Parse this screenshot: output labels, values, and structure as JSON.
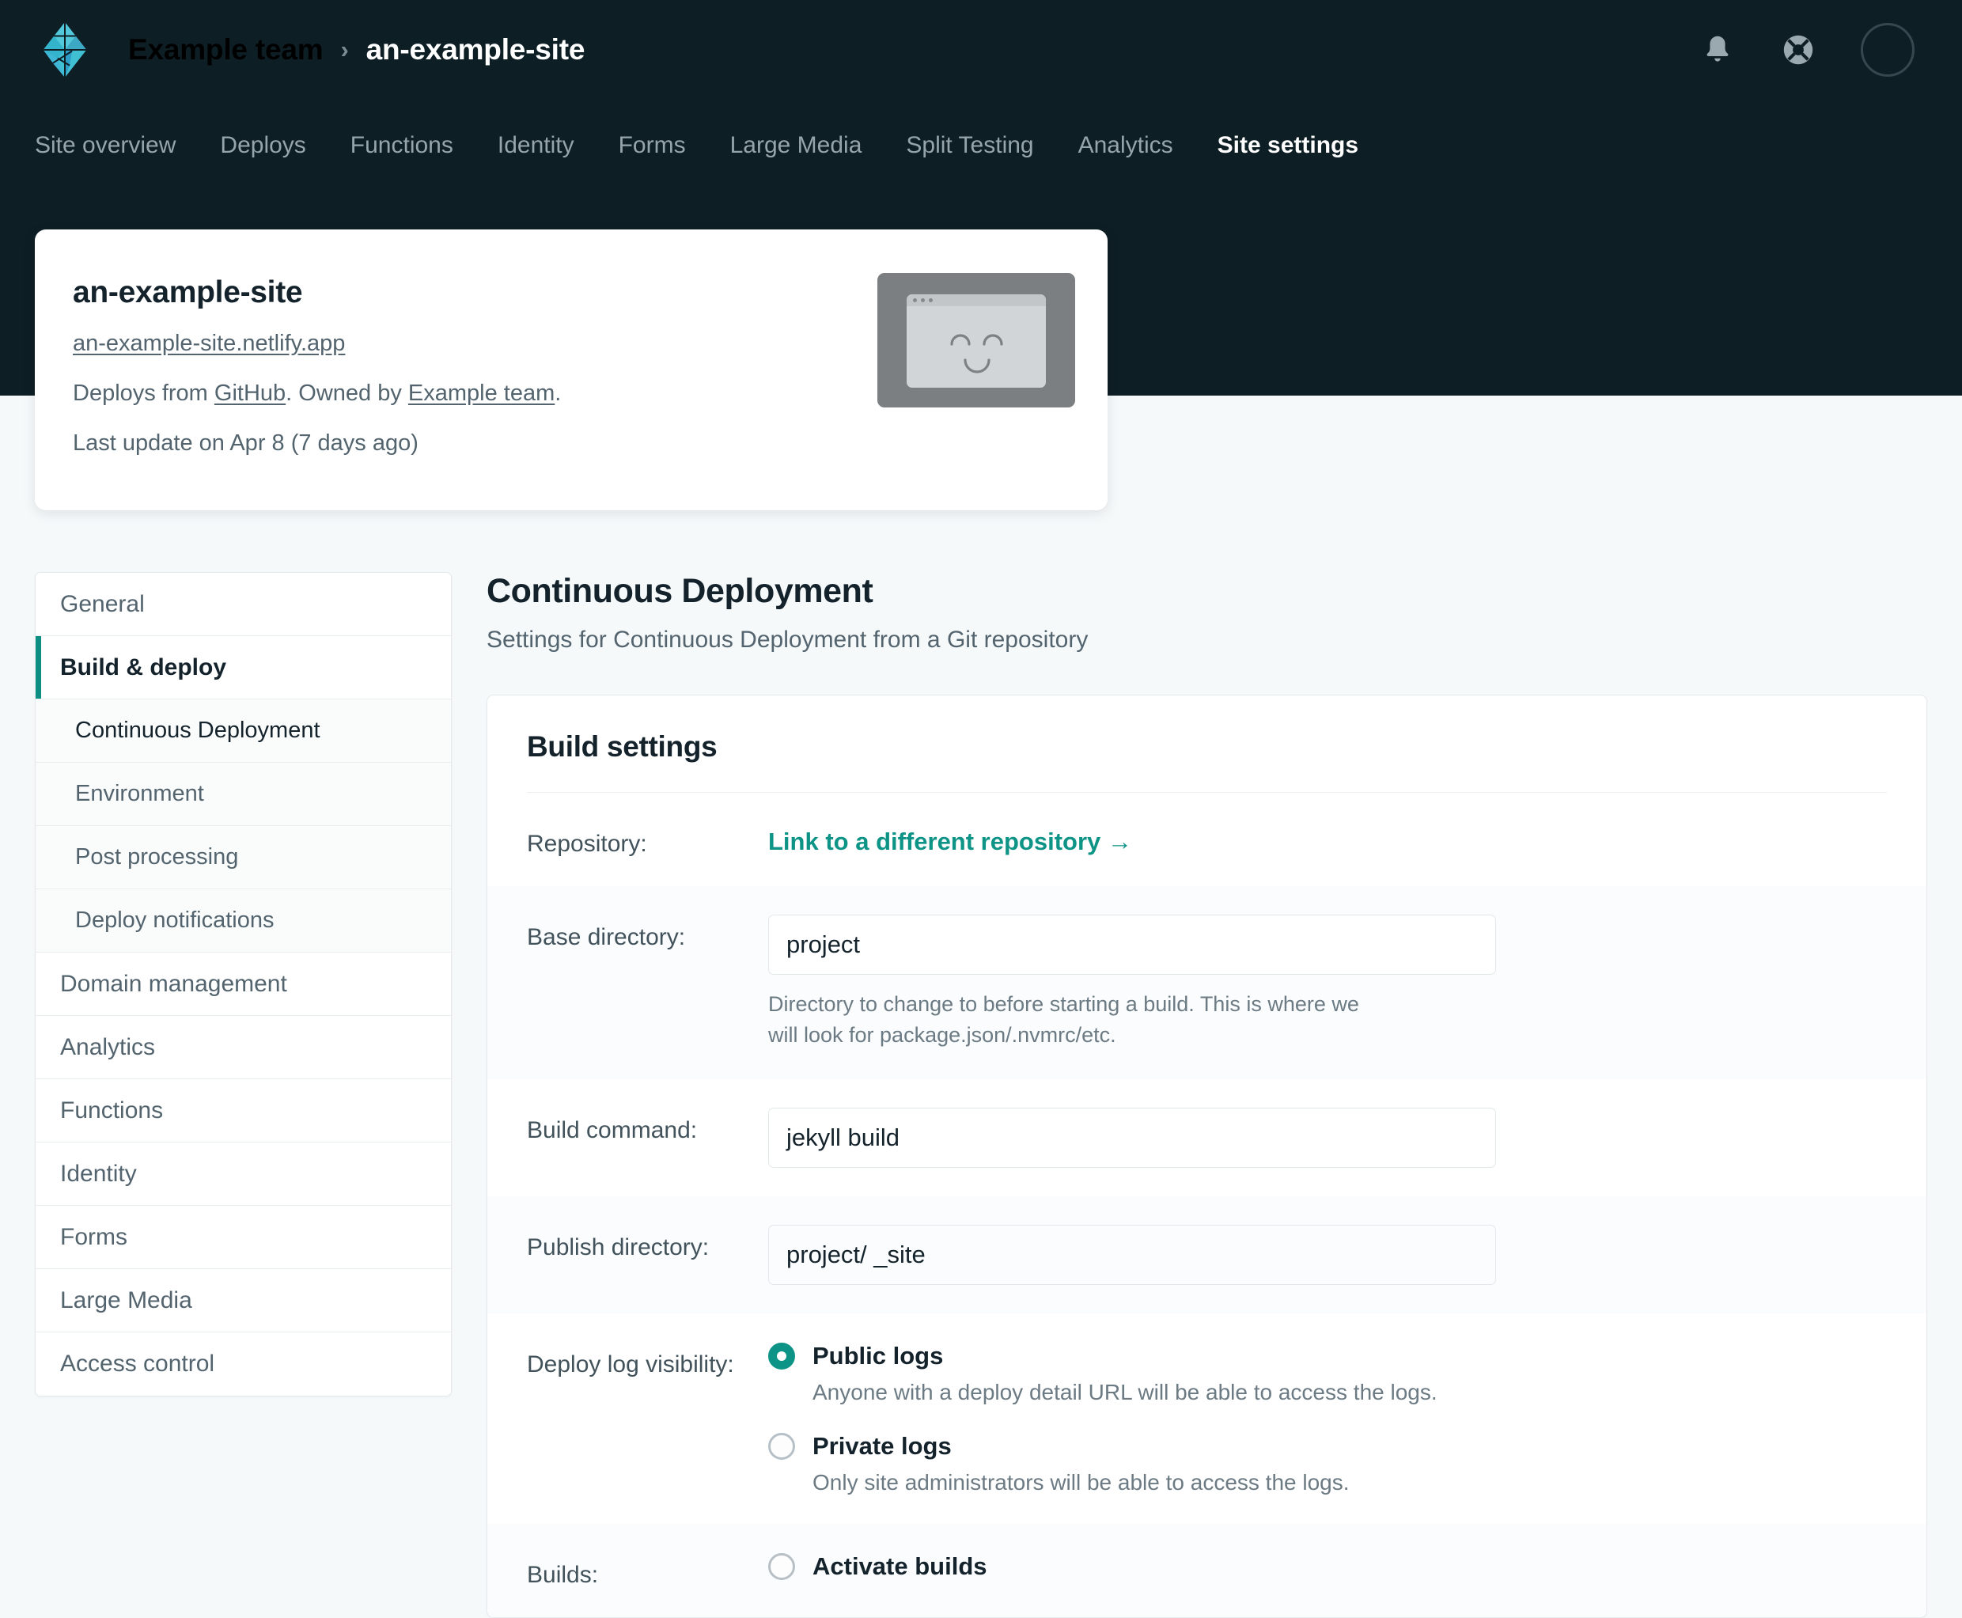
{
  "header": {
    "logo_icon": "netlify-diamond-logo",
    "breadcrumb": {
      "team": "Example team",
      "separator": "›",
      "site": "an-example-site"
    },
    "actions": [
      {
        "icon": "bell-icon",
        "name": "notifications"
      },
      {
        "icon": "life-ring-icon",
        "name": "help"
      },
      {
        "icon": "avatar-icon",
        "name": "user-avatar"
      }
    ],
    "nav": [
      {
        "label": "Site overview",
        "active": false
      },
      {
        "label": "Deploys",
        "active": false
      },
      {
        "label": "Functions",
        "active": false
      },
      {
        "label": "Identity",
        "active": false
      },
      {
        "label": "Forms",
        "active": false
      },
      {
        "label": "Large Media",
        "active": false
      },
      {
        "label": "Split Testing",
        "active": false
      },
      {
        "label": "Analytics",
        "active": false
      },
      {
        "label": "Site settings",
        "active": true
      }
    ]
  },
  "site_card": {
    "title": "an-example-site",
    "url": "an-example-site.netlify.app",
    "deploys_prefix": "Deploys from ",
    "deploys_source": "GitHub",
    "owned_mid": ". Owned by ",
    "owner": "Example team",
    "owned_suffix": ".",
    "last_update": "Last update on Apr 8 (7 days ago)",
    "thumbnail_icon": "smiley-browser-placeholder"
  },
  "settings_nav": [
    {
      "label": "General",
      "level": "top",
      "active": false
    },
    {
      "label": "Build & deploy",
      "level": "top",
      "active": true
    },
    {
      "label": "Continuous Deployment",
      "level": "sub",
      "current": true
    },
    {
      "label": "Environment",
      "level": "sub",
      "current": false
    },
    {
      "label": "Post processing",
      "level": "sub",
      "current": false
    },
    {
      "label": "Deploy notifications",
      "level": "sub",
      "current": false
    },
    {
      "label": "Domain management",
      "level": "top",
      "active": false
    },
    {
      "label": "Analytics",
      "level": "top",
      "active": false
    },
    {
      "label": "Functions",
      "level": "top",
      "active": false
    },
    {
      "label": "Identity",
      "level": "top",
      "active": false
    },
    {
      "label": "Forms",
      "level": "top",
      "active": false
    },
    {
      "label": "Large Media",
      "level": "top",
      "active": false
    },
    {
      "label": "Access control",
      "level": "top",
      "active": false
    }
  ],
  "main": {
    "title": "Continuous Deployment",
    "subtitle": "Settings for Continuous Deployment from a Git repository",
    "panel_title": "Build settings",
    "rows": {
      "repository": {
        "label": "Repository:",
        "link_label": "Link to a different repository →"
      },
      "base_directory": {
        "label": "Base directory:",
        "value": "project",
        "help": "Directory to change to before starting a build. This is where we will look for package.json/.nvmrc/etc."
      },
      "build_command": {
        "label": "Build command:",
        "value": "jekyll build"
      },
      "publish_directory": {
        "label": "Publish directory:",
        "value": "project/  _site"
      },
      "deploy_log_visibility": {
        "label": "Deploy log visibility:",
        "options": [
          {
            "label": "Public logs",
            "help": "Anyone with a deploy detail URL will be able to access the logs.",
            "selected": true
          },
          {
            "label": "Private logs",
            "help": "Only site administrators will be able to access the logs.",
            "selected": false
          }
        ]
      },
      "builds": {
        "label": "Builds:",
        "option_label": "Activate builds",
        "selected": false
      }
    }
  },
  "colors": {
    "header_bg": "#0e1e25",
    "page_bg": "#f5f9fa",
    "accent_teal": "#0e9486",
    "active_bar": "#0e8f84",
    "text_dark": "#14222b",
    "text_muted": "#53646e"
  }
}
